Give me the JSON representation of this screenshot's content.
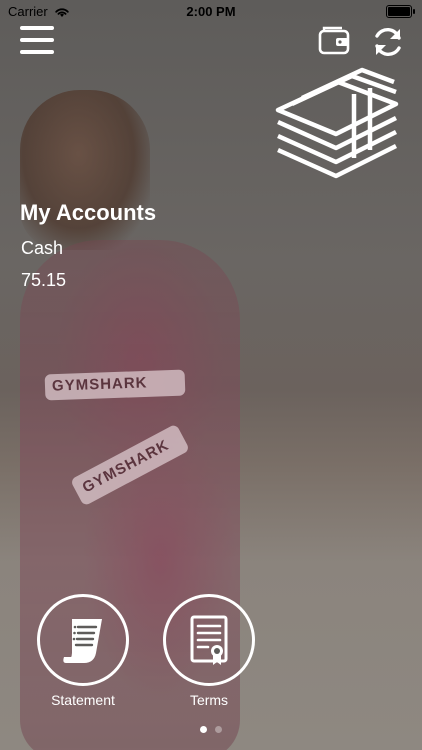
{
  "status_bar": {
    "carrier": "Carrier",
    "time": "2:00 PM",
    "wifi_icon": "wifi-icon",
    "battery_level": 1.0
  },
  "header": {
    "menu_icon": "hamburger-menu-icon",
    "wallet_icon": "wallet-icon",
    "refresh_icon": "refresh-icon",
    "hero_icon": "money-stack-icon"
  },
  "account": {
    "title": "My Accounts",
    "name": "Cash",
    "balance": "75.15"
  },
  "background": {
    "shirt_text_1": "GYMSHARK",
    "shirt_text_2": "GYMSHARK"
  },
  "actions": [
    {
      "label": "Statement",
      "icon": "statement-document-icon"
    },
    {
      "label": "Terms",
      "icon": "terms-certificate-icon"
    }
  ],
  "pager": {
    "pages": 2,
    "current": 1
  },
  "colors": {
    "foreground": "#ffffff",
    "overlay": "#5e5c5a"
  }
}
